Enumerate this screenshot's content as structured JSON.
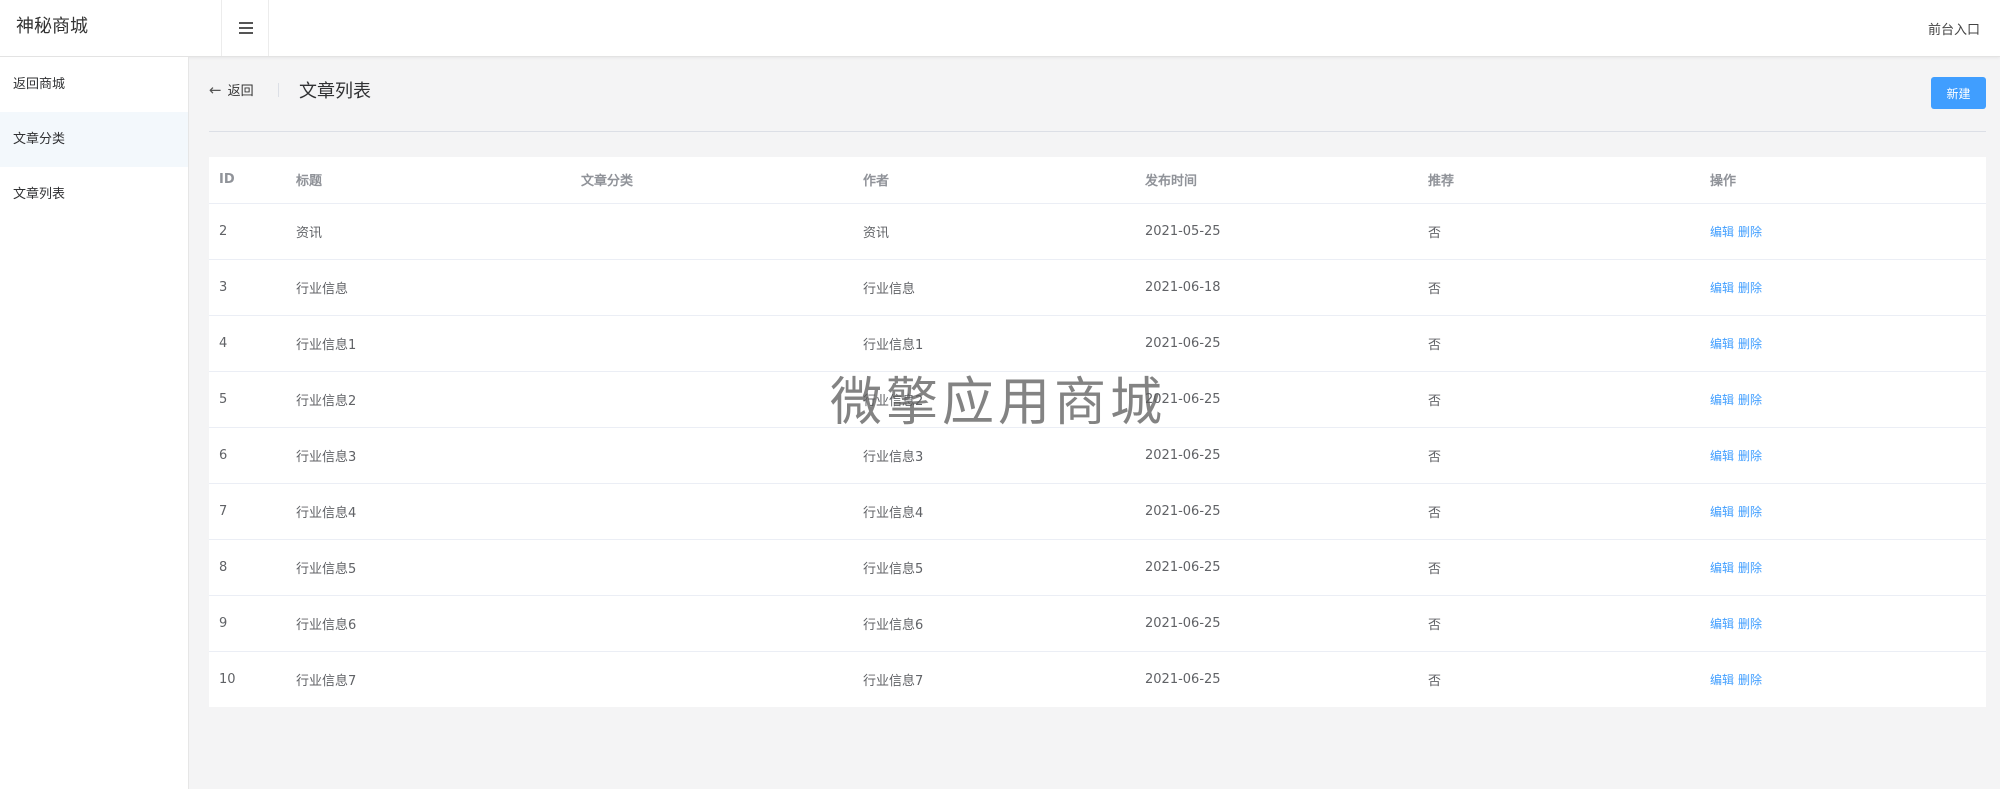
{
  "app": {
    "brand": "神秘商城",
    "front_link": "前台入口"
  },
  "sidebar": {
    "items": [
      {
        "label": "返回商城"
      },
      {
        "label": "文章分类"
      },
      {
        "label": "文章列表"
      }
    ]
  },
  "header": {
    "back_label": "返回",
    "title": "文章列表",
    "new_button": "新建"
  },
  "table": {
    "columns": [
      "ID",
      "标题",
      "文章分类",
      "作者",
      "发布时间",
      "推荐",
      "操作"
    ],
    "edit_label": "编辑",
    "delete_label": "删除",
    "rows": [
      {
        "id": "2",
        "title": "资讯",
        "category": "",
        "author": "资讯",
        "date": "2021-05-25",
        "recommend": "否"
      },
      {
        "id": "3",
        "title": "行业信息",
        "category": "",
        "author": "行业信息",
        "date": "2021-06-18",
        "recommend": "否"
      },
      {
        "id": "4",
        "title": "行业信息1",
        "category": "",
        "author": "行业信息1",
        "date": "2021-06-25",
        "recommend": "否"
      },
      {
        "id": "5",
        "title": "行业信息2",
        "category": "",
        "author": "行业信息2",
        "date": "2021-06-25",
        "recommend": "否"
      },
      {
        "id": "6",
        "title": "行业信息3",
        "category": "",
        "author": "行业信息3",
        "date": "2021-06-25",
        "recommend": "否"
      },
      {
        "id": "7",
        "title": "行业信息4",
        "category": "",
        "author": "行业信息4",
        "date": "2021-06-25",
        "recommend": "否"
      },
      {
        "id": "8",
        "title": "行业信息5",
        "category": "",
        "author": "行业信息5",
        "date": "2021-06-25",
        "recommend": "否"
      },
      {
        "id": "9",
        "title": "行业信息6",
        "category": "",
        "author": "行业信息6",
        "date": "2021-06-25",
        "recommend": "否"
      },
      {
        "id": "10",
        "title": "行业信息7",
        "category": "",
        "author": "行业信息7",
        "date": "2021-06-25",
        "recommend": "否"
      }
    ]
  },
  "watermark": "微擎应用商城",
  "colors": {
    "accent": "#409eff",
    "sidebar_active_bg": "#f3f8fc",
    "page_bg": "#f4f4f5"
  }
}
